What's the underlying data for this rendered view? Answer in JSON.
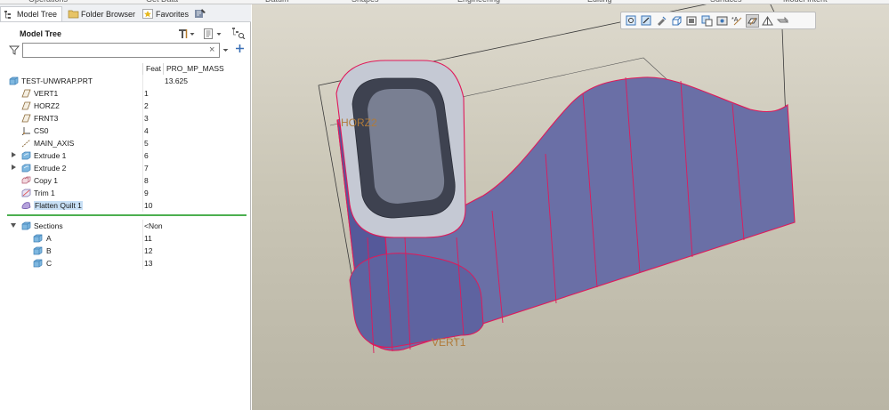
{
  "ribbon": {
    "groups": [
      "Operations",
      "Get Data",
      "Datum",
      "Shapes",
      "Engineering",
      "Editing",
      "Surfaces",
      "Model Intent"
    ]
  },
  "nav_tabs": [
    {
      "label": "Model Tree",
      "active": true
    },
    {
      "label": "Folder Browser",
      "active": false
    },
    {
      "label": "Favorites",
      "active": false
    }
  ],
  "tree_panel": {
    "title": "Model Tree",
    "search": {
      "value": "",
      "placeholder": ""
    },
    "columns": {
      "feat": "Feat",
      "mass": "PRO_MP_MASS"
    }
  },
  "tree": [
    {
      "label": "TEST-UNWRAP.PRT",
      "feat": "",
      "mass": "13.625",
      "icon": "part-icon",
      "indent": 0,
      "expander": false
    },
    {
      "label": "VERT1",
      "feat": "1",
      "mass": "",
      "icon": "datum-plane-icon",
      "indent": 1,
      "expander": false
    },
    {
      "label": "HORZ2",
      "feat": "2",
      "mass": "",
      "icon": "datum-plane-icon",
      "indent": 1,
      "expander": false
    },
    {
      "label": "FRNT3",
      "feat": "3",
      "mass": "",
      "icon": "datum-plane-icon",
      "indent": 1,
      "expander": false
    },
    {
      "label": "CS0",
      "feat": "4",
      "mass": "",
      "icon": "coordinate-system-icon",
      "indent": 1,
      "expander": false
    },
    {
      "label": "MAIN_AXIS",
      "feat": "5",
      "mass": "",
      "icon": "datum-axis-icon",
      "indent": 1,
      "expander": false
    },
    {
      "label": "Extrude 1",
      "feat": "6",
      "mass": "",
      "icon": "extrude-icon",
      "indent": 1,
      "expander": true
    },
    {
      "label": "Extrude 2",
      "feat": "7",
      "mass": "",
      "icon": "extrude-icon",
      "indent": 1,
      "expander": true
    },
    {
      "label": "Copy 1",
      "feat": "8",
      "mass": "",
      "icon": "copy-icon",
      "indent": 1,
      "expander": false
    },
    {
      "label": "Trim 1",
      "feat": "9",
      "mass": "",
      "icon": "trim-icon",
      "indent": 1,
      "expander": false
    },
    {
      "label": "Flatten Quilt 1",
      "feat": "10",
      "mass": "",
      "icon": "flatten-quilt-icon",
      "indent": 1,
      "expander": false,
      "highlighted": true
    }
  ],
  "sections": {
    "label": "Sections",
    "feat": "<Non",
    "items": [
      {
        "label": "A",
        "feat": "11"
      },
      {
        "label": "B",
        "feat": "12"
      },
      {
        "label": "C",
        "feat": "13"
      }
    ]
  },
  "viewport": {
    "datum_labels": {
      "horz": "HORZ2",
      "vert": "VERT1"
    },
    "toolbar_icons": [
      "refit-icon",
      "zoom-in-icon",
      "zoom-out-icon",
      "repaint-icon",
      "display-style-icon",
      "saved-views-icon",
      "view-manager-icon",
      "annotation-display-icon",
      "datum-display-icon",
      "spin-center-icon",
      "appearance-icon",
      "render-icon"
    ],
    "colors": {
      "surface": "#6a6fa6",
      "surface_dark": "#55599a",
      "inner": "#c5c9d4",
      "edge": "#e0195a",
      "datum": "#3a3a3a",
      "datum_text": "#b07b3a"
    }
  }
}
